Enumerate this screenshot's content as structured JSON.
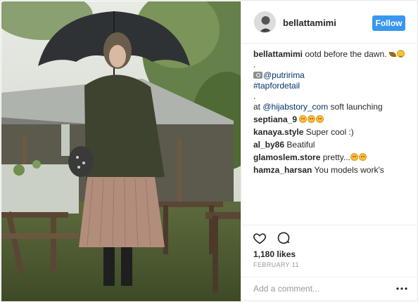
{
  "post": {
    "username": "bellattamimi",
    "follow_label": "Follow",
    "caption": {
      "user": "bellattamimi",
      "text": "ootd before the dawn.",
      "dot1": ".",
      "credit": "@putririma",
      "tag": "#tapfordetail",
      "dot2": ".",
      "launch_prefix": "at ",
      "launch_link": "@hijabstory_com",
      "launch_suffix": " soft launching"
    },
    "comments": [
      {
        "user": "septiana_9",
        "text": ""
      },
      {
        "user": "kanaya.style",
        "text": "Super cool :)"
      },
      {
        "user": "al_by86",
        "text": "Beatiful"
      },
      {
        "user": "glamoslem.store",
        "text": "pretty..."
      },
      {
        "user": "hamza_harsan",
        "text": "You models work's"
      }
    ],
    "likes": "1,180 likes",
    "date": "FEBRUARY 11",
    "comment_placeholder": "Add a comment..."
  },
  "icons": {
    "like": "heart-icon",
    "comment": "comment-bubble-icon",
    "more": "more-options-icon",
    "camera": "camera-emoji",
    "leaf": "leaf-emoji",
    "heart_eyes": "heart-eyes-emoji",
    "smile": "smile-emoji"
  },
  "colors": {
    "follow_button": "#3897f0",
    "link": "#003569",
    "muted": "#999999"
  }
}
